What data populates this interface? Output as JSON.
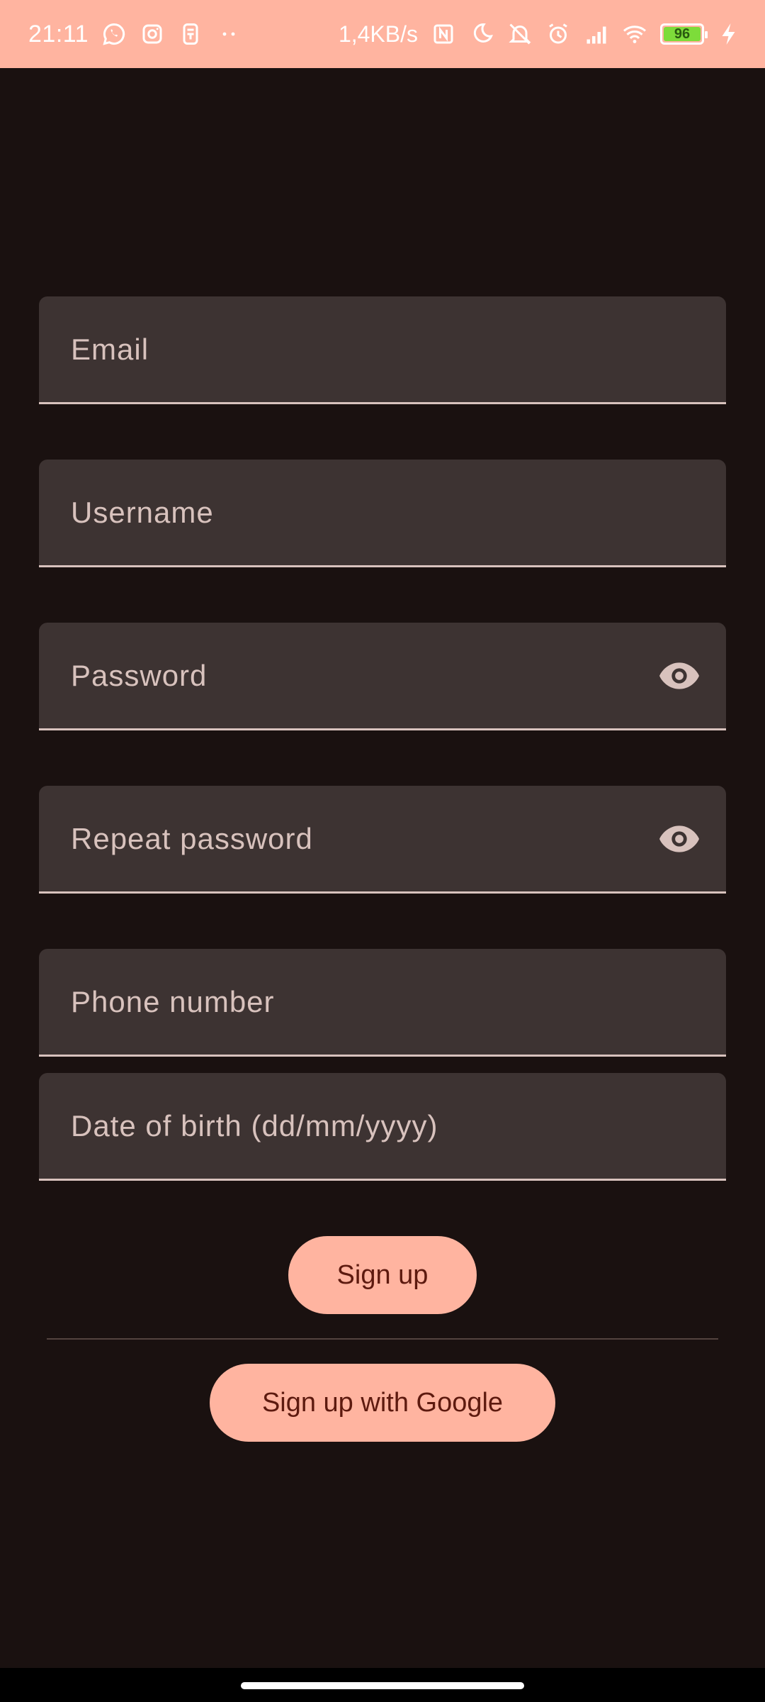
{
  "status_bar": {
    "time": "21:11",
    "network_speed": "1,4KB/s",
    "battery": "96",
    "left_icons": [
      "whatsapp-icon",
      "instagram-icon",
      "app-icon",
      "more-dots-icon"
    ],
    "right_icons": [
      "nfc-icon",
      "moon-icon",
      "bell-off-icon",
      "alarm-icon",
      "signal-icon",
      "wifi-icon",
      "battery-icon",
      "charging-icon"
    ]
  },
  "form": {
    "email_label": "Email",
    "username_label": "Username",
    "password_label": "Password",
    "repeat_password_label": "Repeat password",
    "phone_label": "Phone number",
    "dob_label": "Date of birth (dd/mm/yyyy)"
  },
  "buttons": {
    "signup": "Sign up",
    "signup_google": "Sign up with Google"
  },
  "colors": {
    "accent": "#ffb4a0",
    "background": "#1a1110",
    "field_bg": "#3d3332",
    "field_text": "#d8c2bd",
    "button_text": "#5d1a0f"
  }
}
